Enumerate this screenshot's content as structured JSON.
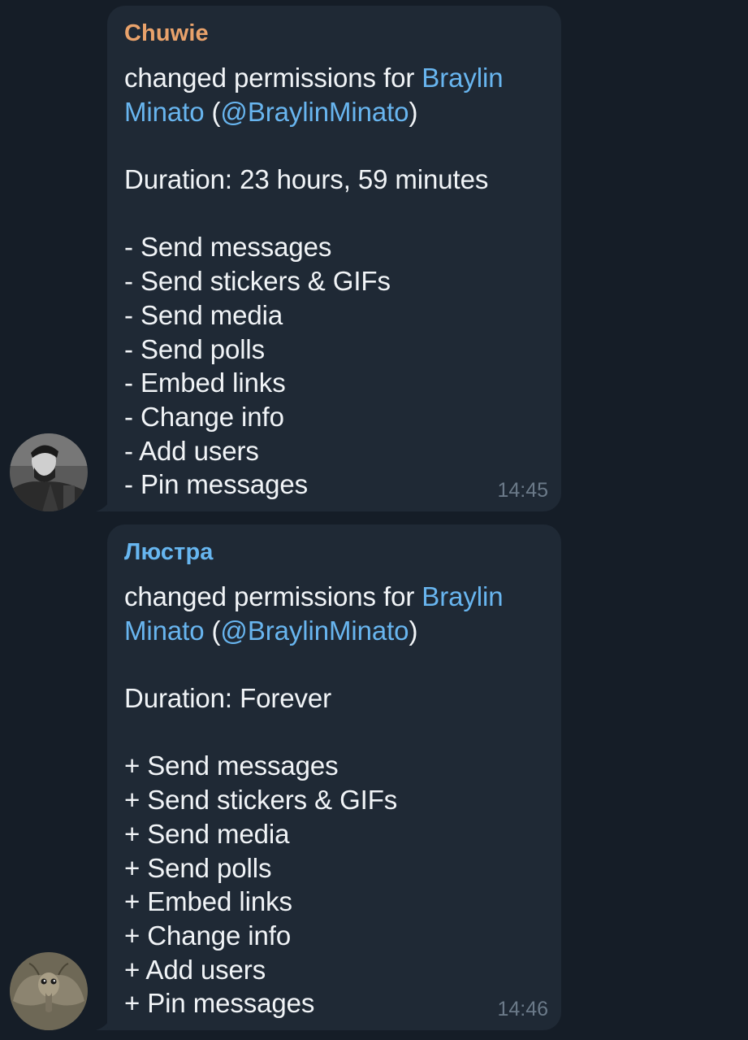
{
  "messages": [
    {
      "sender": "Chuwie",
      "sender_color": "#e9a26b",
      "action": "changed permissions for ",
      "target_name_1": "Braylin",
      "target_name_2": "Minato",
      "paren_open": " (",
      "target_handle": "@BraylinMinato",
      "paren_close": ")",
      "duration": "Duration: 23 hours, 59 minutes",
      "permissions": [
        "- Send messages",
        "- Send stickers & GIFs",
        "- Send media",
        "- Send polls",
        "- Embed links",
        "- Change info",
        "- Add users",
        "- Pin messages"
      ],
      "time": "14:45",
      "avatar_icon": "user-photo-avatar"
    },
    {
      "sender": "Люстра",
      "sender_color": "#67b6f0",
      "action": "changed permissions for ",
      "target_name_1": "Braylin",
      "target_name_2": "Minato",
      "paren_open": " (",
      "target_handle": "@BraylinMinato",
      "paren_close": ")",
      "duration": "Duration: Forever",
      "permissions": [
        "+ Send messages",
        "+ Send stickers & GIFs",
        "+ Send media",
        "+ Send polls",
        "+ Embed links",
        "+ Change info",
        "+ Add users",
        "+ Pin messages"
      ],
      "time": "14:46",
      "avatar_icon": "moth-photo-avatar"
    }
  ],
  "colors": {
    "background": "#151d27",
    "bubble": "#1f2935",
    "text": "#f1f4f7",
    "link": "#68b5ef",
    "time": "#6b7a89"
  }
}
